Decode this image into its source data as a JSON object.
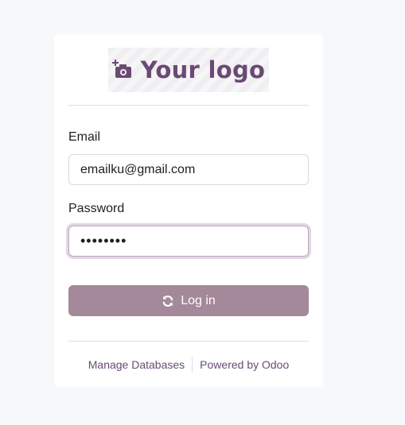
{
  "logo": {
    "text": "Your logo",
    "icon": "camera-plus-icon"
  },
  "form": {
    "email_label": "Email",
    "email_value": "emailku@gmail.com",
    "password_label": "Password",
    "password_value": "••••••••",
    "login_label": "Log in",
    "login_icon": "refresh-icon"
  },
  "footer": {
    "manage_databases": "Manage Databases",
    "powered_by": "Powered by Odoo"
  },
  "colors": {
    "brand": "#6a4a74",
    "button": "#a38999",
    "background": "#f7f8fa"
  }
}
